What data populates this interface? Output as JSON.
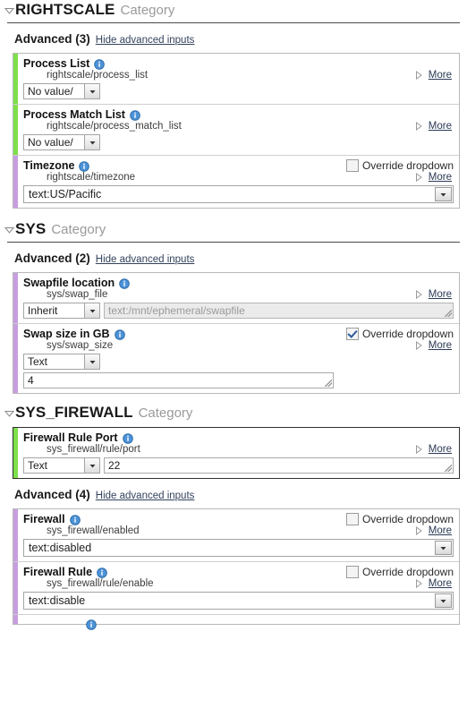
{
  "icons": {
    "collapse_triangle": "triangle-down-icon",
    "more_triangle": "triangle-right-icon",
    "info": "info-icon",
    "dropdown_arrow": "chevron-down-icon"
  },
  "colors": {
    "accent_green": "#7ee04b",
    "accent_purple": "#c79ee0",
    "link": "#2b3a55",
    "category_word": "#9a9a9a"
  },
  "labels": {
    "category_suffix": "Category",
    "advanced": "Advanced",
    "hide_advanced": "Hide advanced inputs",
    "more": "More",
    "override_dropdown": "Override dropdown"
  },
  "categories": [
    {
      "name": "RIGHTSCALE",
      "suffix": "Category",
      "has_rule": true,
      "advanced_count": "(3)",
      "advanced_link": "Hide advanced inputs",
      "inputs": [
        {
          "label": "Process List",
          "path": "rightscale/process_list",
          "accent": "green",
          "control": "combo",
          "combo_value": "No value/",
          "more": "More",
          "override": false,
          "has_override": false
        },
        {
          "label": "Process Match List",
          "path": "rightscale/process_match_list",
          "accent": "green",
          "control": "combo",
          "combo_value": "No value/",
          "more": "More",
          "override": false,
          "has_override": false
        },
        {
          "label": "Timezone",
          "path": "rightscale/timezone",
          "accent": "purple",
          "control": "wide-select",
          "select_value": "text:US/Pacific",
          "more": "More",
          "override": false,
          "has_override": true
        }
      ]
    },
    {
      "name": "SYS",
      "suffix": "Category",
      "has_rule": true,
      "advanced_count": "(2)",
      "advanced_link": "Hide advanced inputs",
      "inputs": [
        {
          "label": "Swapfile location",
          "path": "sys/swap_file",
          "accent": "purple",
          "control": "combo-text",
          "combo_value": "Inherit",
          "text_value": "text:/mnt/ephemeral/swapfile",
          "text_disabled": true,
          "more": "More",
          "override": false,
          "has_override": false
        },
        {
          "label": "Swap size in GB",
          "path": "sys/swap_size",
          "accent": "purple",
          "control": "combo-stacked-text",
          "combo_value": "Text",
          "text_value": "4",
          "text_disabled": false,
          "more": "More",
          "override": true,
          "has_override": true
        }
      ]
    },
    {
      "name": "SYS_FIREWALL",
      "suffix": "Category",
      "has_rule": false,
      "advanced_count": "(4)",
      "advanced_link": "Hide advanced inputs",
      "primary_inputs": [
        {
          "label": "Firewall Rule Port",
          "path": "sys_firewall/rule/port",
          "accent": "green",
          "control": "combo-text",
          "combo_value": "Text",
          "text_value": "22",
          "text_disabled": false,
          "more": "More",
          "override": false,
          "has_override": false
        }
      ],
      "inputs": [
        {
          "label": "Firewall",
          "path": "sys_firewall/enabled",
          "accent": "purple",
          "control": "wide-select",
          "select_value": "text:disabled",
          "more": "More",
          "override": false,
          "has_override": true
        },
        {
          "label": "Firewall Rule",
          "path": "sys_firewall/rule/enable",
          "accent": "purple",
          "control": "wide-select",
          "select_value": "text:disable",
          "more": "More",
          "override": false,
          "has_override": true
        }
      ]
    }
  ]
}
